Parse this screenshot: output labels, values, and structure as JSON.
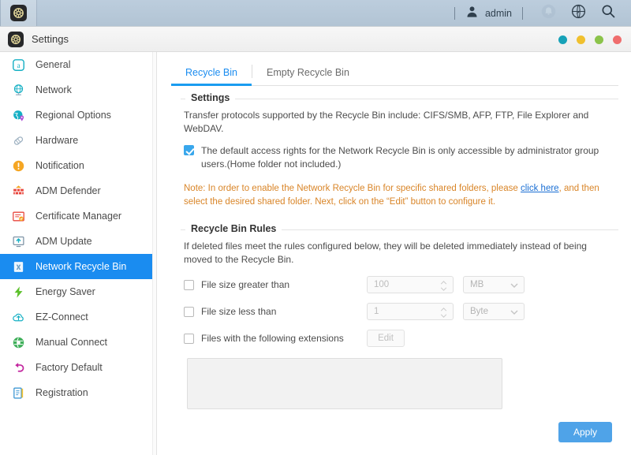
{
  "topbar": {
    "task_app_icon": "gear-icon",
    "user_label": "admin",
    "user_icon": "user-avatar-icon",
    "notification_icon": "bell-icon",
    "globe_icon": "globe-compass-icon",
    "search_icon": "search-icon",
    "background_color": "#b8c9d9"
  },
  "window": {
    "title": "Settings",
    "title_icon": "gear-icon",
    "controls": [
      {
        "name": "window-control-teal",
        "color": "#17a2b8"
      },
      {
        "name": "window-control-yellow",
        "color": "#f0c02e"
      },
      {
        "name": "window-control-green",
        "color": "#8bc34a"
      },
      {
        "name": "window-control-red",
        "color": "#ef6d6d"
      }
    ]
  },
  "sidebar": {
    "items": [
      {
        "label": "General",
        "icon": "general-icon",
        "active": false
      },
      {
        "label": "Network",
        "icon": "network-globe-icon",
        "active": false
      },
      {
        "label": "Regional Options",
        "icon": "regional-options-icon",
        "active": false
      },
      {
        "label": "Hardware",
        "icon": "hardware-icon",
        "active": false
      },
      {
        "label": "Notification",
        "icon": "notification-icon",
        "active": false
      },
      {
        "label": "ADM Defender",
        "icon": "adm-defender-icon",
        "active": false
      },
      {
        "label": "Certificate Manager",
        "icon": "certificate-manager-icon",
        "active": false
      },
      {
        "label": "ADM Update",
        "icon": "adm-update-icon",
        "active": false
      },
      {
        "label": "Network Recycle Bin",
        "icon": "recycle-bin-icon",
        "active": true
      },
      {
        "label": "Energy Saver",
        "icon": "energy-saver-icon",
        "active": false
      },
      {
        "label": "EZ-Connect",
        "icon": "ez-connect-icon",
        "active": false
      },
      {
        "label": "Manual Connect",
        "icon": "manual-connect-icon",
        "active": false
      },
      {
        "label": "Factory Default",
        "icon": "factory-default-icon",
        "active": false
      },
      {
        "label": "Registration",
        "icon": "registration-icon",
        "active": false
      }
    ],
    "active_color": "#1a8cf0"
  },
  "tabs": [
    {
      "label": "Recycle Bin",
      "active": true
    },
    {
      "label": "Empty Recycle Bin",
      "active": false
    }
  ],
  "settings_section": {
    "legend": "Settings",
    "description": "Transfer protocols supported by the Recycle Bin include: CIFS/SMB, AFP, FTP, File Explorer and WebDAV.",
    "checkbox": {
      "checked": true,
      "label": "The default access rights for the Network Recycle Bin is only accessible by administrator group users.(Home folder not included.)"
    },
    "note_before_link": "Note: In order to enable the Network Recycle Bin for specific shared folders, please ",
    "note_link": "click here",
    "note_after_link": ", and then select the desired shared folder. Next, click on the “Edit” button to configure it.",
    "note_color": "#d98528"
  },
  "rules_section": {
    "legend": "Recycle Bin Rules",
    "description": "If deleted files meet the rules configured below, they will be deleted immediately instead of being moved to the Recycle Bin.",
    "rules": [
      {
        "label": "File size greater than",
        "checked": false,
        "value": "100",
        "unit": "MB",
        "control": "spinner"
      },
      {
        "label": "File size less than",
        "checked": false,
        "value": "1",
        "unit": "Byte",
        "control": "spinner"
      },
      {
        "label": "Files with the following extensions",
        "checked": false,
        "button_label": "Edit",
        "control": "button"
      }
    ],
    "extensions_value": ""
  },
  "footer": {
    "apply_label": "Apply",
    "apply_color": "#4fa3e8"
  }
}
